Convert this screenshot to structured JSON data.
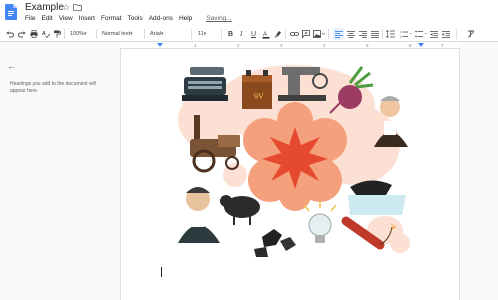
{
  "document": {
    "title": "Example",
    "saving_status": "Saving..."
  },
  "menu": [
    "File",
    "Edit",
    "View",
    "Insert",
    "Format",
    "Tools",
    "Add-ons",
    "Help"
  ],
  "toolbar": {
    "zoom": "100%",
    "style": "Normal text",
    "font": "Arial",
    "font_size": "11"
  },
  "ruler": {
    "ticks": [
      "1",
      "2",
      "3",
      "4",
      "5",
      "6",
      "7"
    ]
  },
  "outline": {
    "hint": "Headings you add to the document will appear here."
  },
  "colors": {
    "docs_blue": "#4285f4",
    "blob_peach": "#fde0d4",
    "starburst_orange": "#f4a07c",
    "starburst_red": "#e64a2e",
    "text_dark": "#202124",
    "icon_gray": "#5f6368"
  },
  "icons": [
    "docs-logo-icon",
    "star-icon",
    "folder-icon",
    "undo-icon",
    "redo-icon",
    "print-icon",
    "spellcheck-icon",
    "paint-format-icon",
    "bold-icon",
    "italic-icon",
    "underline-icon",
    "text-color-icon",
    "highlight-icon",
    "link-icon",
    "comment-icon",
    "image-icon",
    "align-left-icon",
    "align-center-icon",
    "align-right-icon",
    "justify-icon",
    "line-spacing-icon",
    "numbered-list-icon",
    "bulleted-list-icon",
    "decrease-indent-icon",
    "increase-indent-icon",
    "clear-formatting-icon",
    "back-arrow-icon"
  ]
}
